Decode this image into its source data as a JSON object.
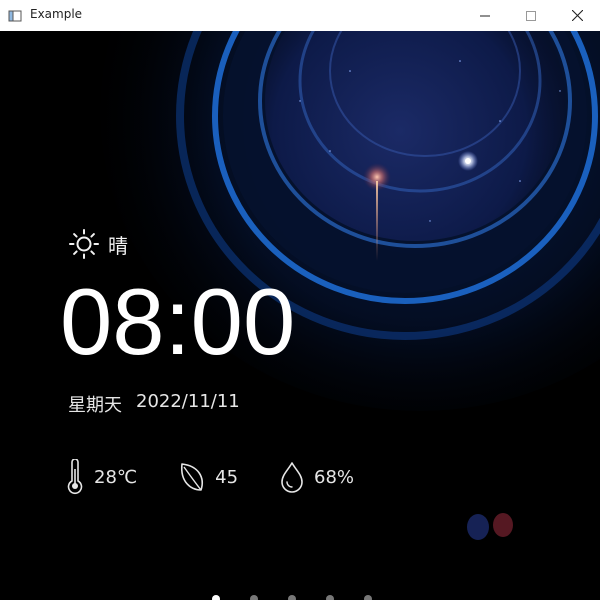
{
  "window": {
    "title": "Example",
    "icon": "app-window-icon"
  },
  "controls": {
    "minimize": "minimize-icon",
    "maximize": "maximize-icon",
    "close": "close-icon"
  },
  "weather": {
    "icon": "sun-icon",
    "condition": "晴"
  },
  "clock": {
    "time": "08:00"
  },
  "date": {
    "weekday": "星期天",
    "date": "2022/11/11"
  },
  "stats": {
    "temperature": {
      "icon": "thermometer-icon",
      "value": "28℃"
    },
    "air_quality": {
      "icon": "leaf-icon",
      "value": "45"
    },
    "humidity": {
      "icon": "water-drop-icon",
      "value": "68%"
    }
  },
  "pager": {
    "pages": 5,
    "active_index": 0
  },
  "colors": {
    "titlebar": "#ffffff",
    "background": "#000000",
    "ring_blue": "#1a6bd0",
    "text": "#ffffff"
  }
}
